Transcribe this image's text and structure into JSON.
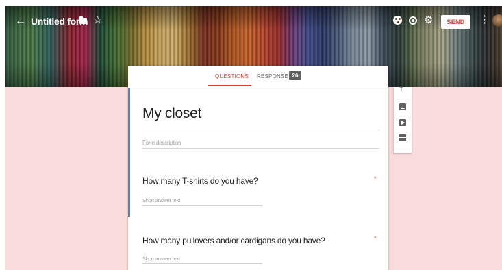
{
  "app": {
    "form_name": "Untitled form",
    "send_label": "SEND",
    "accent": "#db4437",
    "page_background": "#f9dbdb",
    "question_indicator": "#4285f4"
  },
  "icons": {
    "back": "arrow-back-icon",
    "folder": "folder-icon",
    "star": "star-icon",
    "palette": "palette-icon",
    "preview": "eye-icon",
    "settings": "gear-icon",
    "more": "more-vert-icon",
    "toolbar": [
      "title-text-icon",
      "image-icon",
      "video-icon",
      "section-icon"
    ]
  },
  "tabs": {
    "questions": "QUESTIONS",
    "responses": "RESPONSES",
    "responses_count": "26",
    "active": "questions"
  },
  "form": {
    "title": "My closet",
    "description_placeholder": "Form description"
  },
  "questions": [
    {
      "text": "How many T-shirts do you have?",
      "required_mark": "*",
      "answer_placeholder": "Short answer text"
    },
    {
      "text": "How many pullovers and/or cardigans do you have?",
      "required_mark": "*",
      "answer_placeholder": "Short answer text"
    }
  ]
}
